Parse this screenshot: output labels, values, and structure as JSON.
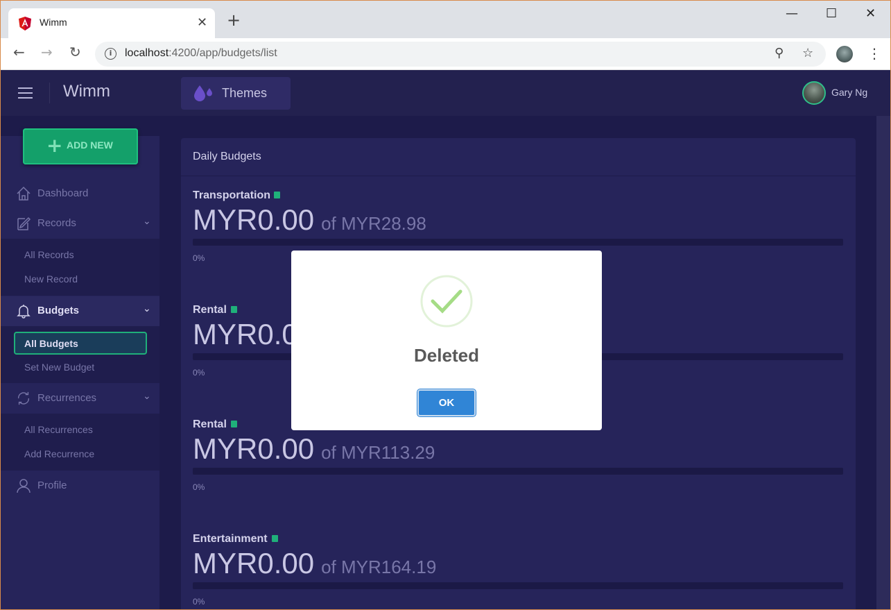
{
  "browser": {
    "tab_title": "Wimm",
    "tab_close": "✕",
    "new_tab": "+",
    "url_host": "localhost",
    "url_path": ":4200/app/budgets/list",
    "window_controls": {
      "minimize": "—",
      "maximize": "☐",
      "close": "✕"
    },
    "nav": {
      "back": "←",
      "forward": "→",
      "reload": "↻"
    },
    "omni_icons": {
      "zoom": "⚲",
      "star": "☆"
    },
    "menu": "⋮"
  },
  "app": {
    "brand": "Wimm",
    "themes_label": "Themes",
    "user_name": "Gary Ng",
    "add_new_label": "ADD NEW",
    "add_new_plus": "+",
    "sidebar": {
      "dashboard": "Dashboard",
      "records": "Records",
      "records_sub": [
        "All Records",
        "New Record"
      ],
      "budgets": "Budgets",
      "budgets_sub": [
        "All Budgets",
        "Set New Budget"
      ],
      "recurrences": "Recurrences",
      "recurrences_sub": [
        "All Recurrences",
        "Add Recurrence"
      ],
      "profile": "Profile",
      "chevron": "⌄"
    },
    "card_title": "Daily Budgets",
    "budgets": [
      {
        "name": "Transportation",
        "amount": "MYR0.00",
        "of": "of MYR28.98",
        "percent": "0%",
        "progress": 0
      },
      {
        "name": "Rental",
        "amount": "MYR0.00",
        "of": "",
        "percent": "0%",
        "progress": 0
      },
      {
        "name": "Rental",
        "amount": "MYR0.00",
        "of": "of MYR113.29",
        "percent": "0%",
        "progress": 0
      },
      {
        "name": "Entertainment",
        "amount": "MYR0.00",
        "of": "of MYR164.19",
        "percent": "0%",
        "progress": 0
      }
    ]
  },
  "modal": {
    "title": "Deleted",
    "ok_label": "OK"
  },
  "colors": {
    "accent": "#1fb07a",
    "button_blue": "#3085d6",
    "background": "#1d1b4a"
  }
}
